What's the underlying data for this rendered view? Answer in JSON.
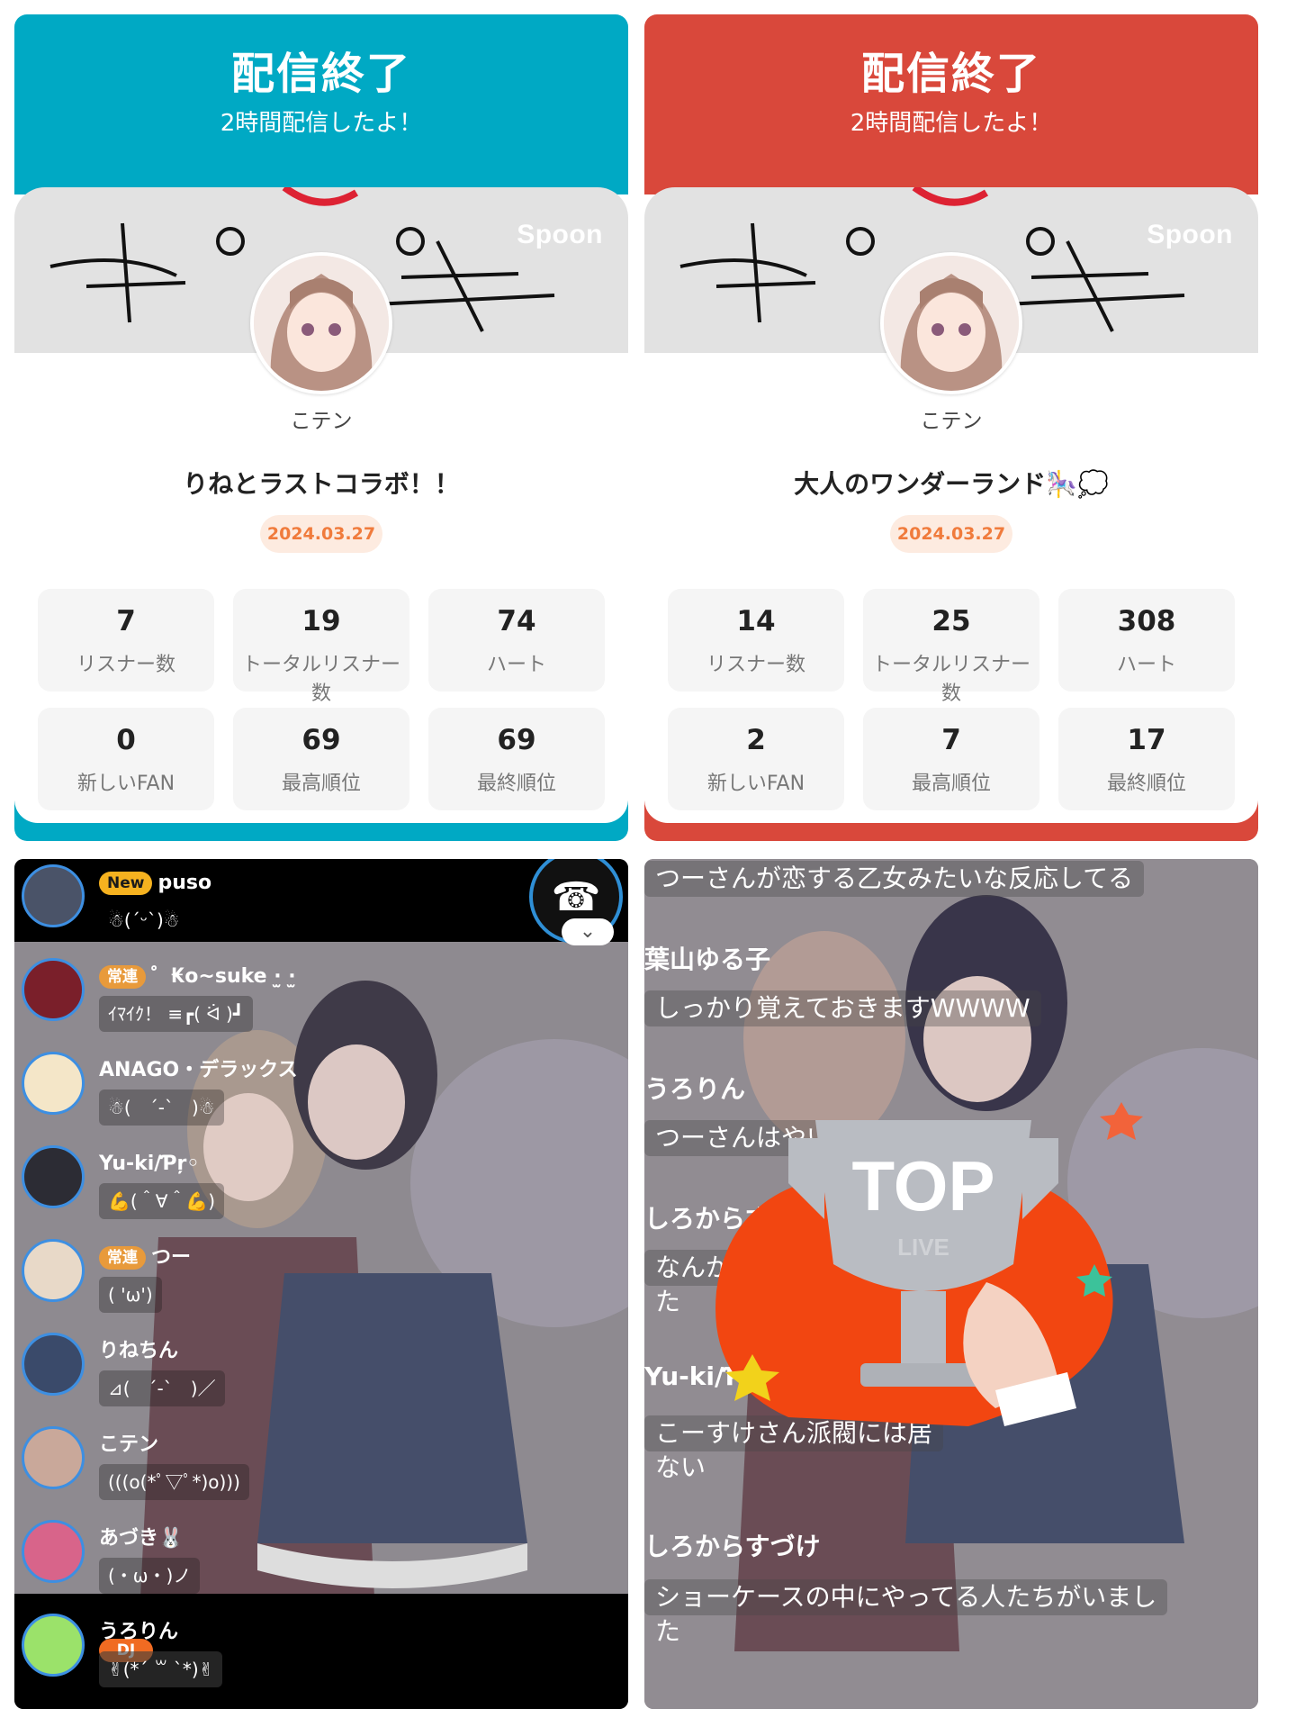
{
  "summaries": [
    {
      "header_title": "配信終了",
      "header_subtitle": "2時間配信したよ！",
      "accent_color": "#00a9c4",
      "brand": "Spoon",
      "dj_name": "こテン",
      "broadcast_title": "りねとラストコラボ！！",
      "date": "2024.03.27",
      "stats": [
        {
          "value": "7",
          "label": "リスナー数"
        },
        {
          "value": "19",
          "label": "トータルリスナー数"
        },
        {
          "value": "74",
          "label": "ハート"
        },
        {
          "value": "0",
          "label": "新しいFAN"
        },
        {
          "value": "69",
          "label": "最高順位"
        },
        {
          "value": "69",
          "label": "最終順位"
        }
      ]
    },
    {
      "header_title": "配信終了",
      "header_subtitle": "2時間配信したよ！",
      "accent_color": "#d9483b",
      "brand": "Spoon",
      "dj_name": "こテン",
      "broadcast_title": "大人のワンダーランド🎠💭",
      "date": "2024.03.27",
      "stats": [
        {
          "value": "14",
          "label": "リスナー数"
        },
        {
          "value": "25",
          "label": "トータルリスナー数"
        },
        {
          "value": "308",
          "label": "ハート"
        },
        {
          "value": "2",
          "label": "新しいFAN"
        },
        {
          "value": "7",
          "label": "最高順位"
        },
        {
          "value": "17",
          "label": "最終順位"
        }
      ]
    }
  ],
  "listener_chat": [
    {
      "badge": "New",
      "name": "puso",
      "text": "☃(ˊᵕˋ)☃"
    },
    {
      "badge": "常連",
      "name": "゜₭o~suke ·̫ ·̫",
      "text": "ｲﾏｲｸ！ ≡┏( ᐛ )┛"
    },
    {
      "badge": "",
      "name": "ANAGO・デラックス",
      "text": "☃(　ˊ-ˋ　)☃"
    },
    {
      "badge": "",
      "name": "Yu-ki/Ƥŗ◦",
      "text": "💪(＾∀＾💪)"
    },
    {
      "badge": "常連",
      "name": "つー",
      "text": "( 'ω')"
    },
    {
      "badge": "",
      "name": "りねちん",
      "text": "⊿(　ˊ-ˋ　)／"
    },
    {
      "badge": "DJ",
      "name": "こテン",
      "text": "(((o(*ﾟ▽ﾟ*)o)))"
    },
    {
      "badge": "",
      "name": "あづき🐰",
      "text": "(・ω・)ノ"
    },
    {
      "badge": "",
      "name": "うろりん",
      "text": "✌(*´ ꒳ `*)✌"
    }
  ],
  "right_chat": [
    {
      "type": "text",
      "value": "つーさんが恋する乙女みたいな反応してる"
    },
    {
      "type": "name",
      "value": "葉山ゆる子"
    },
    {
      "type": "text",
      "value": "しっかり覚えておきますWWWW"
    },
    {
      "type": "name",
      "value": "うろりん"
    },
    {
      "type": "text",
      "value": "つーさんはやいね"
    },
    {
      "type": "name",
      "value": "しろからすづ"
    },
    {
      "type": "text",
      "value": "なんか動"
    },
    {
      "type": "text",
      "value": "た"
    },
    {
      "type": "name",
      "value": "Yu-ki/Ƥ"
    },
    {
      "type": "text",
      "value": "こーすけさん派閥には居"
    },
    {
      "type": "text",
      "value": "ない"
    },
    {
      "type": "name",
      "value": "しろからすづけ"
    },
    {
      "type": "text",
      "value": "ショーケースの中にやってる人たちがいまし"
    },
    {
      "type": "text",
      "value": "た"
    }
  ],
  "overlay": {
    "trophy_title": "TOP",
    "trophy_sub": "LIVE"
  },
  "icons": [
    "phone-icon",
    "chevron-down-icon",
    "trophy-icon"
  ]
}
